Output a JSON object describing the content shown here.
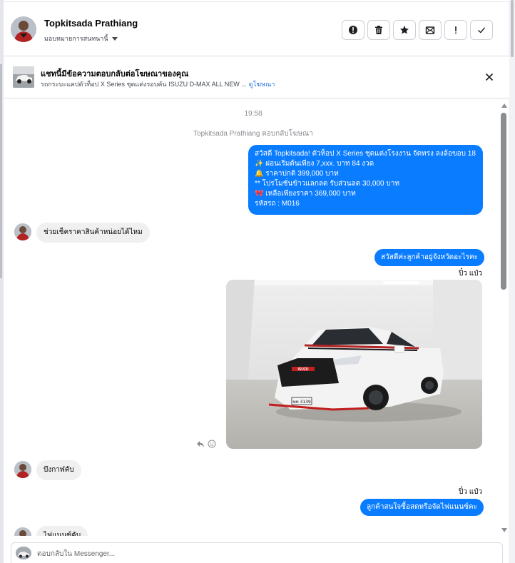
{
  "contact": {
    "name": "Topkitsada Prathiang",
    "assign_label": "มอบหมายการสนทนานี้"
  },
  "toolbar": {
    "icons": [
      "spam-icon",
      "trash-icon",
      "star-icon",
      "mail-unread-icon",
      "exclamation-icon",
      "check-icon"
    ]
  },
  "ad_banner": {
    "title": "แชทนี้มีข้อความตอบกลับต่อโฆษณาของคุณ",
    "subtitle": "รถกระบะแคปตัวท็อป X Series ชุดแต่งรอบคัน ISUZU D-MAX ALL NEW ...",
    "link": "ดูโฆษณา"
  },
  "thread": {
    "timestamp": "19:58",
    "reply_note": "Topkitsada Prathiang ตอบกลับโฆษณา",
    "ad_message_lines": [
      "สวัสดี Topkitsada! ตัวท็อป X Series ชุดแต่งโรงงาน จัดทรง ลงล้อขอบ 18",
      "✨  ผ่อนเริ่มต้นเพียง 7,xxx. บาท 84 งวด",
      "🔔 ราคาปกติ 399,000 บาท",
      "** โปรโมชั่นข้าวแลกลด รับส่วนลด 30,000 บาท",
      "🎀  เหลือเพียงราคา 369,000 บาท",
      "  รหัสรถ : M016"
    ],
    "msg_in_1": "ช่วยเช็คราคาสินค้าหน่อยได้ไหม",
    "msg_out_1": "สวัสดีค่ะลูกค้าอยู่จังหวัดอะไรคะ",
    "sender_1": "ปิ๋ว แป๋ว",
    "car_plate": "ฆท 3139",
    "car_badge": "ISUZU",
    "msg_in_2": "บึงกาฬคับ",
    "sender_2": "ปิ๋ว แป๋ว",
    "msg_out_2": "ลูกค้าสนใจซื้อสดหรือจัดไฟแนนซ์คะ",
    "msg_in_3_partial": "ไฟแนนซ์คับ"
  },
  "composer": {
    "placeholder": "ตอบกลับใน Messenger..."
  },
  "colors": {
    "accent_blue": "#0a7cff",
    "link_blue": "#216fdb",
    "bubble_gray": "#f0f0f0"
  }
}
